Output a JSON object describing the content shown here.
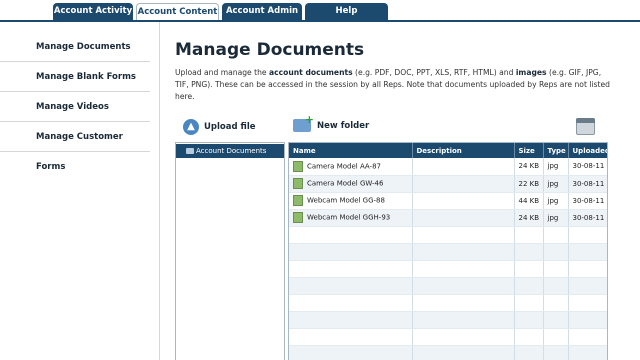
{
  "tabs": [
    {
      "label": "Account Activity"
    },
    {
      "label": "Account Content"
    },
    {
      "label": "Account Admin"
    },
    {
      "label": "Help"
    }
  ],
  "sidebar": {
    "items": [
      {
        "label": "Manage Documents"
      },
      {
        "label": "Manage Blank Forms"
      },
      {
        "label": "Manage Videos"
      },
      {
        "label": "Manage Customer Forms"
      }
    ]
  },
  "main": {
    "title": "Manage Documents",
    "desc": {
      "p1": "Upload and manage the ",
      "b1": "account documents",
      "p2": " (e.g. PDF, DOC, PPT, XLS, RTF, HTML) and ",
      "b2": "images",
      "p3": " (e.g. GIF, JPG, TIF, PNG). These can be accessed in the session by all Reps. Note that documents uploaded by Reps are not listed here."
    },
    "upload_label": "Upload file",
    "new_folder_label": "New folder"
  },
  "tree": {
    "items": [
      {
        "label": "Account Documents"
      }
    ]
  },
  "table": {
    "headers": {
      "name": "Name",
      "description": "Description",
      "size": "Size",
      "type": "Type",
      "uploaded": "Uploaded"
    },
    "rows": [
      {
        "name": "Camera Model AA-87",
        "description": "",
        "size": "24 KB",
        "type": "jpg",
        "uploaded": "30-08-11"
      },
      {
        "name": "Camera Model GW-46",
        "description": "",
        "size": "22 KB",
        "type": "jpg",
        "uploaded": "30-08-11"
      },
      {
        "name": "Webcam Model GG-88",
        "description": "",
        "size": "44 KB",
        "type": "jpg",
        "uploaded": "30-08-11"
      },
      {
        "name": "Webcam Model GGH-93",
        "description": "",
        "size": "24 KB",
        "type": "jpg",
        "uploaded": "30-08-11"
      }
    ]
  },
  "colors": {
    "accent": "#1c4a6e",
    "row_alt": "#eef3f8"
  }
}
